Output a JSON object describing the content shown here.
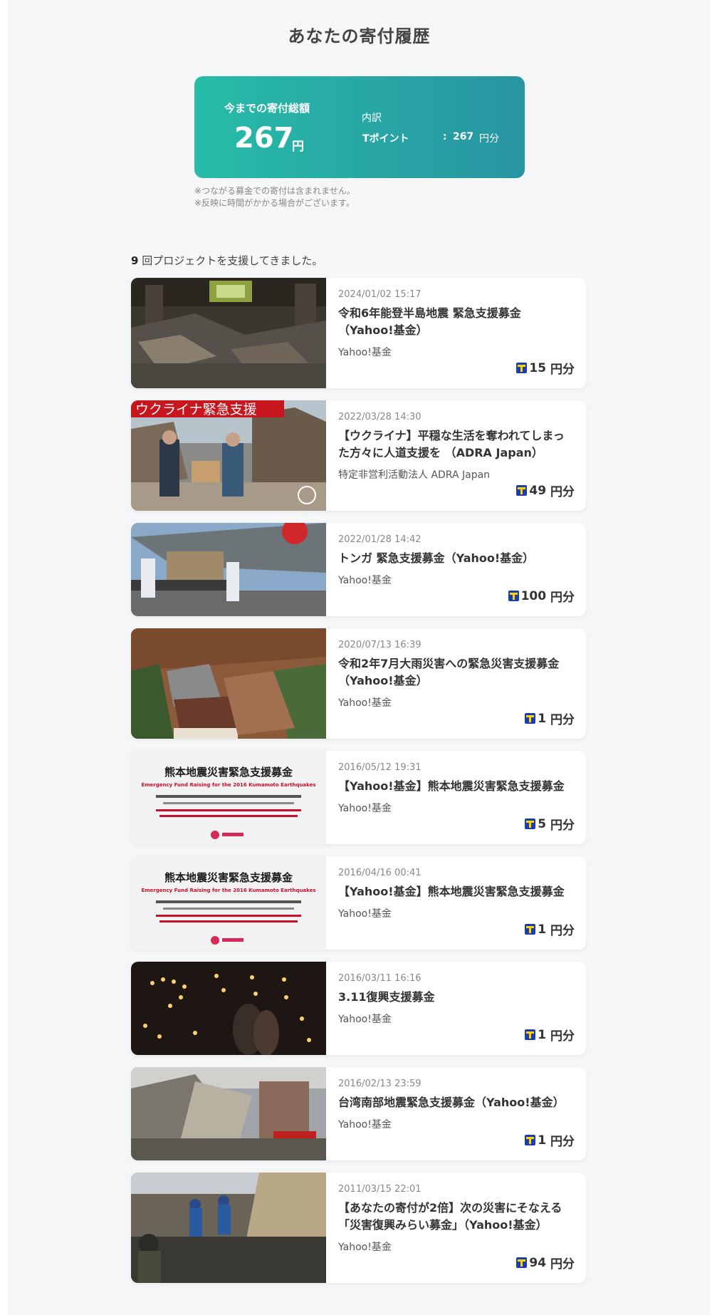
{
  "page": {
    "title": "あなたの寄付履歴"
  },
  "summary": {
    "label": "今までの寄付総額",
    "amount": "267",
    "unit": "円",
    "breakdown": {
      "title": "内訳",
      "method": "Tポイント",
      "colon": ":",
      "amount": "267",
      "unit": "円分"
    },
    "notes": [
      "※つながる募金での寄付は含まれません。",
      "※反映に時間がかかる場合がございます。"
    ]
  },
  "projects": {
    "count": "9",
    "count_suffix": "回プロジェクトを支援してきました。",
    "items": [
      {
        "date": "2024/01/02 15:17",
        "title": "令和6年能登半島地震 緊急支援募金（Yahoo!基金）",
        "org": "Yahoo!基金",
        "amount": "15",
        "unit": "円分"
      },
      {
        "date": "2022/03/28 14:30",
        "title": "【ウクライナ】平穏な生活を奪われてしまった方々に人道支援を （ADRA Japan）",
        "org": "特定非営利活動法人 ADRA Japan",
        "amount": "49",
        "unit": "円分",
        "thumb_text": "ウクライナ緊急支援"
      },
      {
        "date": "2022/01/28 14:42",
        "title": "トンガ 緊急支援募金（Yahoo!基金）",
        "org": "Yahoo!基金",
        "amount": "100",
        "unit": "円分"
      },
      {
        "date": "2020/07/13 16:39",
        "title": "令和2年7月大雨災害への緊急災害支援募金（Yahoo!基金）",
        "org": "Yahoo!基金",
        "amount": "1",
        "unit": "円分"
      },
      {
        "date": "2016/05/12 19:31",
        "title": "【Yahoo!基金】熊本地震災害緊急支援募金",
        "org": "Yahoo!基金",
        "amount": "5",
        "unit": "円分",
        "thumb_text": "熊本地震災害緊急支援募金",
        "thumb_sub": "Emergency Fund Raising for the 2016 Kumamoto Earthquakes"
      },
      {
        "date": "2016/04/16 00:41",
        "title": "【Yahoo!基金】熊本地震災害緊急支援募金",
        "org": "Yahoo!基金",
        "amount": "1",
        "unit": "円分",
        "thumb_text": "熊本地震災害緊急支援募金",
        "thumb_sub": "Emergency Fund Raising for the 2016 Kumamoto Earthquakes"
      },
      {
        "date": "2016/03/11 16:16",
        "title": "3.11復興支援募金",
        "org": "Yahoo!基金",
        "amount": "1",
        "unit": "円分"
      },
      {
        "date": "2016/02/13 23:59",
        "title": "台湾南部地震緊急支援募金（Yahoo!基金）",
        "org": "Yahoo!基金",
        "amount": "1",
        "unit": "円分"
      },
      {
        "date": "2011/03/15 22:01",
        "title": "【あなたの寄付が2倍】次の災害にそなえる「災害復興みらい募金」（Yahoo!基金）",
        "org": "Yahoo!基金",
        "amount": "94",
        "unit": "円分"
      }
    ]
  },
  "colors": {
    "card_start": "#27bca8",
    "card_end": "#2894a2",
    "tpoint_blue": "#1a3eb0",
    "tpoint_yellow": "#ffd200"
  }
}
